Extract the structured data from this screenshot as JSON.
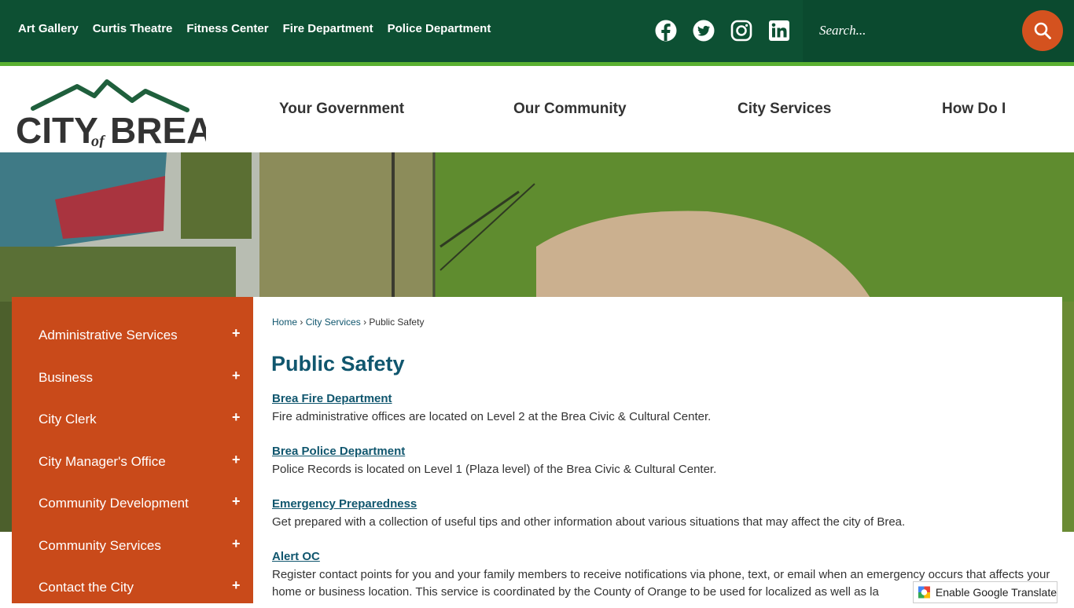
{
  "quicklinks": [
    "Art Gallery",
    "Curtis Theatre",
    "Fitness Center",
    "Fire Department",
    "Police Department"
  ],
  "social": [
    "facebook-icon",
    "twitter-icon",
    "instagram-icon",
    "linkedin-icon"
  ],
  "search": {
    "placeholder": "Search..."
  },
  "logo": {
    "text_city": "CITY",
    "text_of": "of",
    "text_brea": "BREA"
  },
  "nav": [
    "Your Government",
    "Our Community",
    "City Services",
    "How Do I"
  ],
  "sidebar": [
    "Administrative Services",
    "Business",
    "City Clerk",
    "City Manager's Office",
    "Community Development",
    "Community Services",
    "Contact the City"
  ],
  "breadcrumb": {
    "home": "Home",
    "sep1": "›",
    "services": "City Services",
    "sep2": "›",
    "current": "Public Safety"
  },
  "page_title": "Public Safety",
  "entries": [
    {
      "title": "Brea Fire Department",
      "desc": "Fire administrative offices are located on Level 2 at the Brea Civic & Cultural Center."
    },
    {
      "title": "Brea Police Department",
      "desc": "Police Records is located on Level 1 (Plaza level) of the Brea Civic & Cultural Center."
    },
    {
      "title": "Emergency Preparedness",
      "desc": "Get prepared with a collection of useful tips and other information about various situations that may affect the city of Brea."
    },
    {
      "title": "Alert OC",
      "desc": "Register contact points for you and your family members to receive notifications via phone, text, or email when an emergency occurs that affects your home or business location. This service is coordinated by the County of Orange to be used for localized as well as la"
    }
  ],
  "translate_label": "Enable Google Translate",
  "colors": {
    "topbar": "#0d5033",
    "accent_green": "#5ab031",
    "sidebar": "#c94a1a",
    "link": "#10566e"
  }
}
